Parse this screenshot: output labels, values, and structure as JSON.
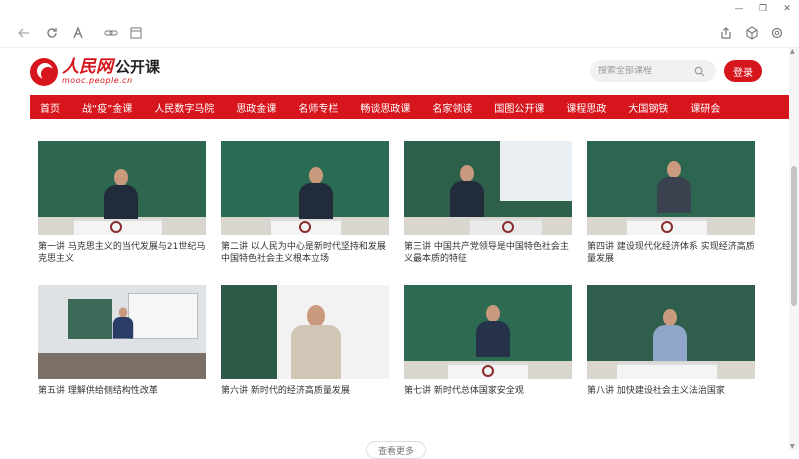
{
  "browser": {
    "controls": {
      "minimize": "—",
      "restore": "❐",
      "close": "✕"
    }
  },
  "logo": {
    "brand": "人民网",
    "product": "公开课",
    "url": "mooc.people.cn"
  },
  "search": {
    "placeholder": "搜索全部课程"
  },
  "login_label": "登录",
  "nav": [
    "首页",
    "战“疫”金课",
    "人民数字马院",
    "思政金课",
    "名师专栏",
    "畅谈思政课",
    "名家领读",
    "国图公开课",
    "课程思政",
    "大国钢铁",
    "课研会"
  ],
  "courses": [
    {
      "title": "第一讲 马克思主义的当代发展与21世纪马克思主义"
    },
    {
      "title": "第二讲 以人民为中心是新时代坚持和发展中国特色社会主义根本立场"
    },
    {
      "title": "第三讲 中国共产党领导是中国特色社会主义最本质的特征"
    },
    {
      "title": "第四讲 建设现代化经济体系 实现经济高质量发展"
    },
    {
      "title": "第五讲 理解供给侧结构性改革"
    },
    {
      "title": "第六讲 新时代的经济高质量发展"
    },
    {
      "title": "第七讲 新时代总体国家安全观"
    },
    {
      "title": "第八讲 加快建设社会主义法治国家"
    }
  ],
  "more_label": "查看更多",
  "colors": {
    "accent": "#d7151d"
  }
}
